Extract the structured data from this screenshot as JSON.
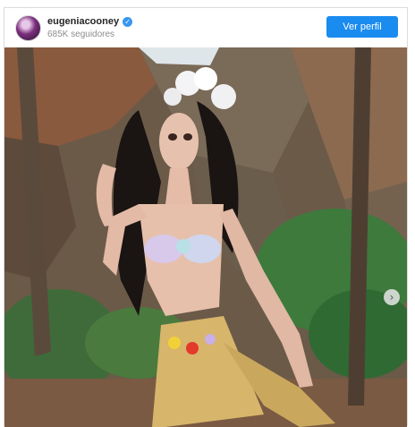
{
  "post": {
    "username": "eugeniacooney",
    "followers": "685K seguidores",
    "follow_label": "Ver perfil",
    "verified_glyph": "✓",
    "next_glyph": "›"
  },
  "icons": {
    "verified": "verified-badge-icon",
    "next": "chevron-right-icon"
  },
  "colors": {
    "accent": "#1a8cf0",
    "verified": "#3897f0",
    "border": "#dbdbdb"
  }
}
